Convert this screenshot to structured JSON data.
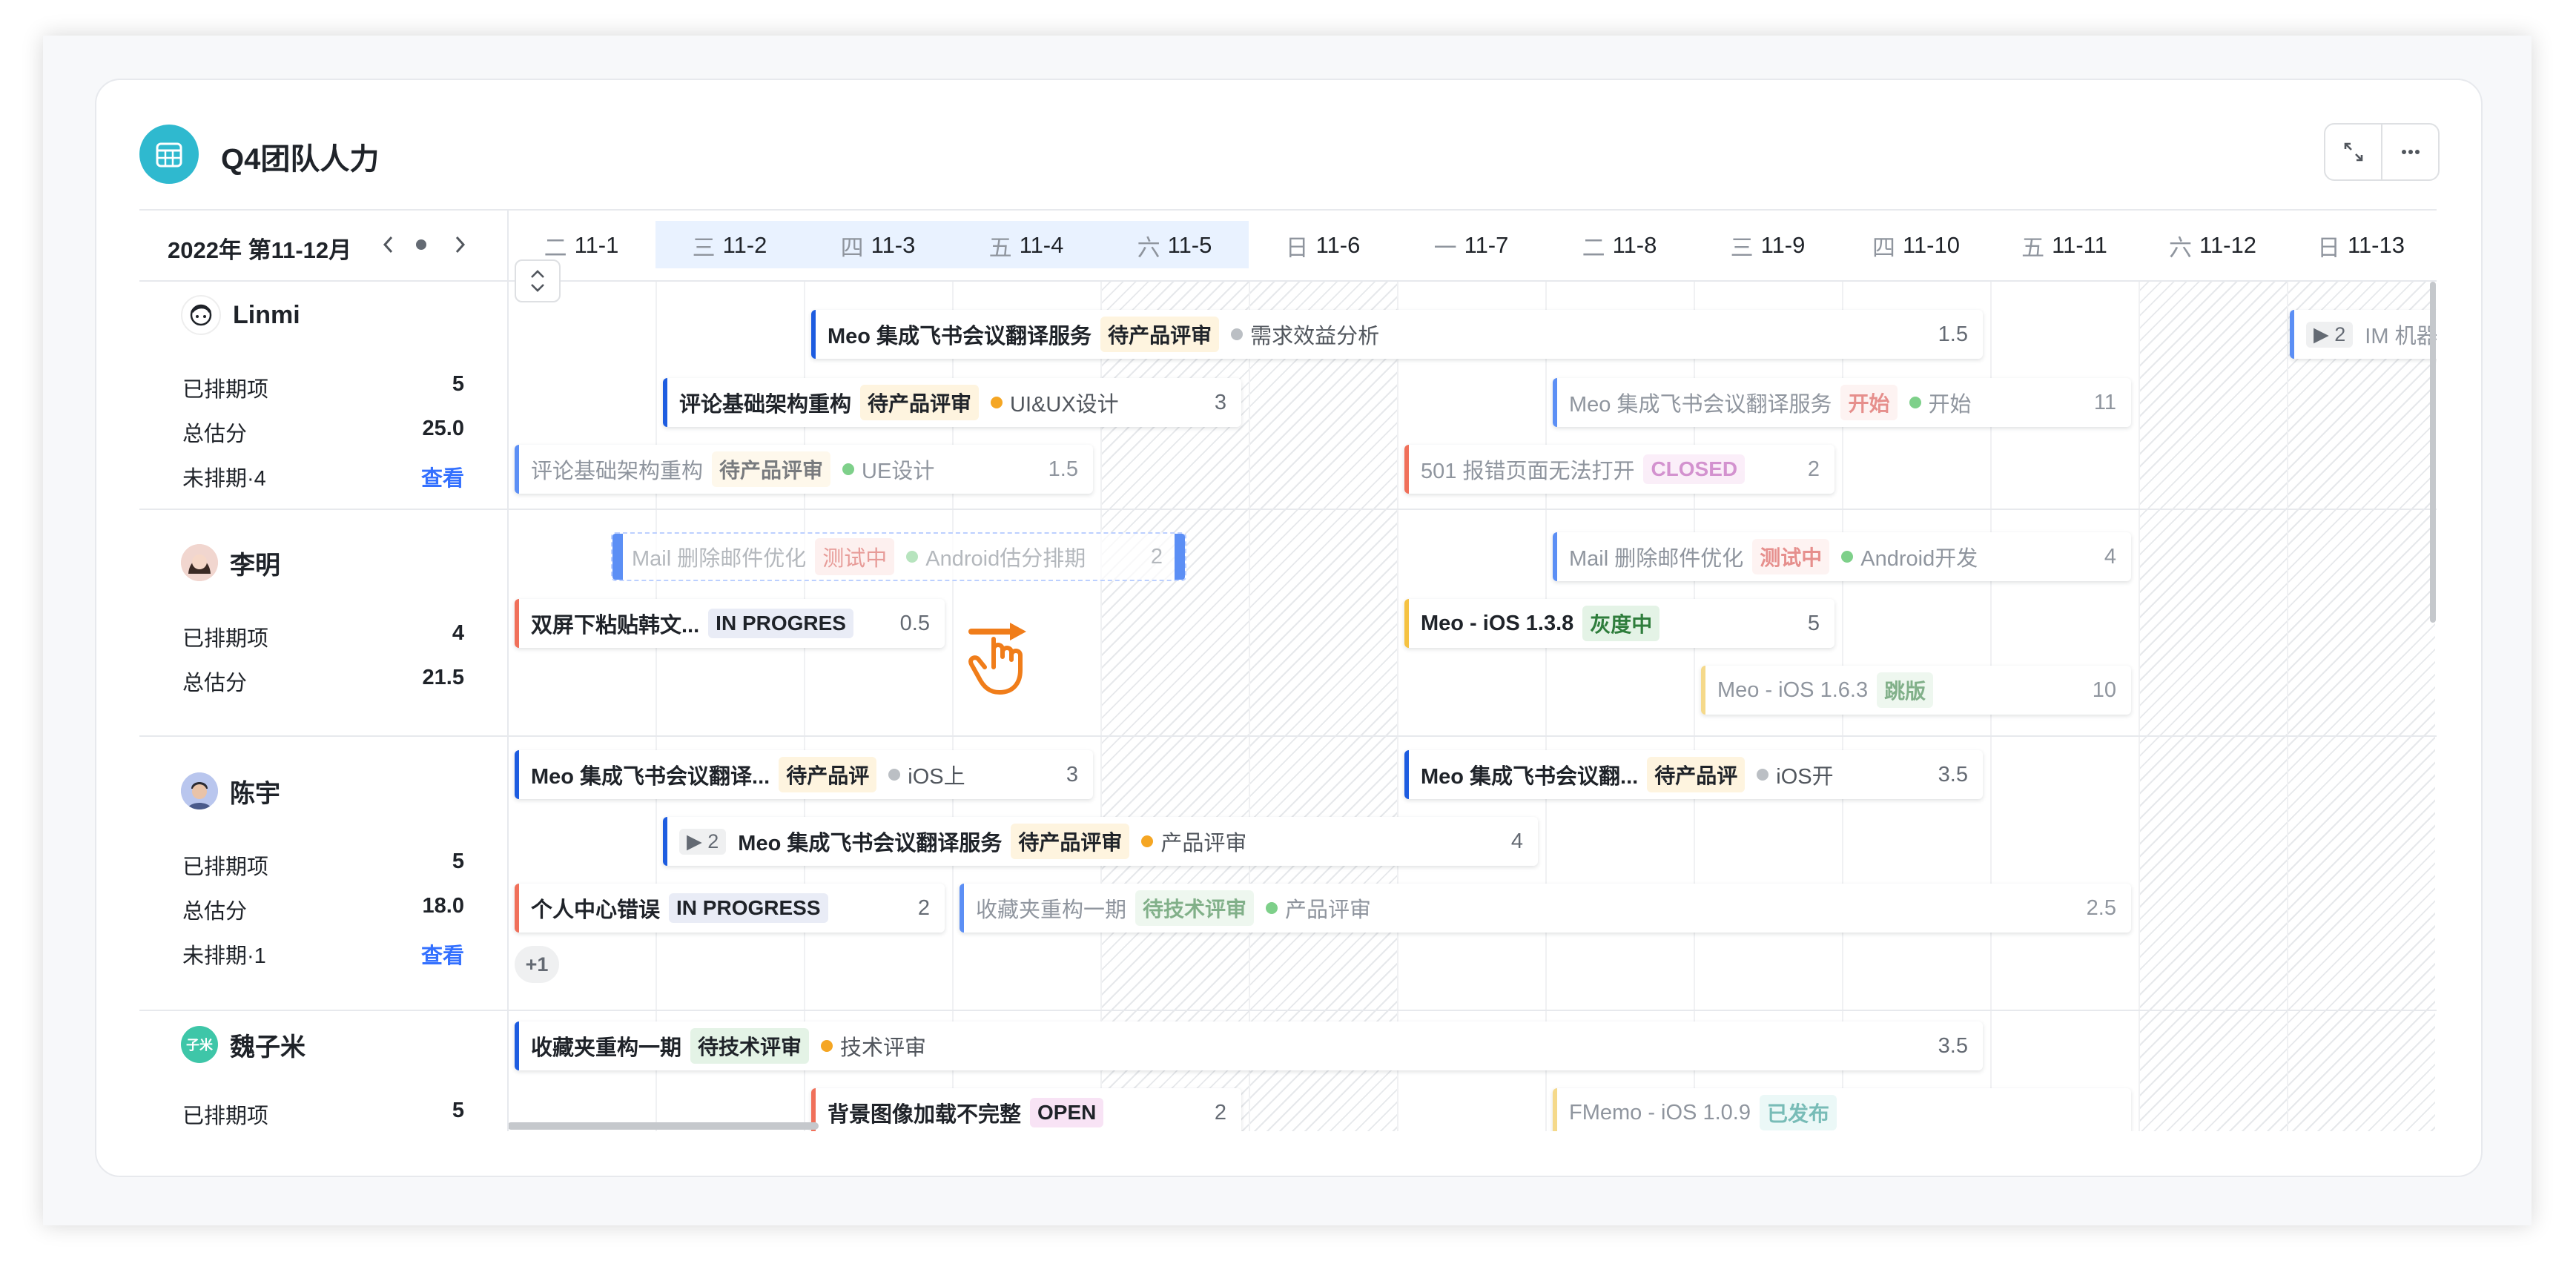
{
  "title": "Q4团队人力",
  "period": "2022年 第11-12月",
  "colors": {
    "accent": "#3370ff",
    "blue": "#1d5ce0",
    "yellow": "#f5c242",
    "red": "#f0705a",
    "header_icon": "#2fb9cf"
  },
  "dates": [
    {
      "wd": "二",
      "d": "11-1"
    },
    {
      "wd": "三",
      "d": "11-2"
    },
    {
      "wd": "四",
      "d": "11-3"
    },
    {
      "wd": "五",
      "d": "11-4"
    },
    {
      "wd": "六",
      "d": "11-5"
    },
    {
      "wd": "日",
      "d": "11-6"
    },
    {
      "wd": "一",
      "d": "11-7"
    },
    {
      "wd": "二",
      "d": "11-8"
    },
    {
      "wd": "三",
      "d": "11-9"
    },
    {
      "wd": "四",
      "d": "11-10"
    },
    {
      "wd": "五",
      "d": "11-11"
    },
    {
      "wd": "六",
      "d": "11-12"
    },
    {
      "wd": "日",
      "d": "11-13"
    }
  ],
  "stat_labels": {
    "scheduled": "已排期项",
    "estimate": "总估分",
    "view": "查看"
  },
  "people": [
    {
      "name": "Linmi",
      "scheduled": "5",
      "estimate": "25.0",
      "unscheduled": "未排期·4",
      "icon": "avatar-face-icon"
    },
    {
      "name": "李明",
      "scheduled": "4",
      "estimate": "21.5",
      "icon": "avatar-photo-icon"
    },
    {
      "name": "陈宇",
      "scheduled": "5",
      "estimate": "18.0",
      "unscheduled": "未排期·1",
      "icon": "avatar-photo-icon"
    },
    {
      "name": "魏子米",
      "scheduled": "5",
      "initials": "子米",
      "icon": "avatar-initials-icon"
    }
  ],
  "tasks": [
    {
      "name": "Meo 集成飞书会议翻译服务",
      "tag": "待产品评审",
      "phase": "需求效益分析",
      "num": "1.5"
    },
    {
      "count": "2",
      "name": "IM 机器"
    },
    {
      "name": "评论基础架构重构",
      "tag": "待产品评审",
      "phase": "UI&UX设计",
      "num": "3"
    },
    {
      "name": "Meo 集成飞书会议翻译服务",
      "tag": "开始",
      "phase": "开始",
      "num": "11"
    },
    {
      "name": "评论基础架构重构",
      "tag": "待产品评审",
      "phase": "UE设计",
      "num": "1.5"
    },
    {
      "name": "501 报错页面无法打开",
      "tag": "CLOSED",
      "num": "2"
    },
    {
      "name": "Mail 删除邮件优化",
      "tag": "测试中",
      "phase": "Android开发",
      "num": "4"
    },
    {
      "name": "双屏下粘贴韩文...",
      "tag": "IN PROGRES",
      "num": "0.5"
    },
    {
      "name": "Meo - iOS 1.3.8",
      "tag": "灰度中",
      "num": "5"
    },
    {
      "name": "Meo - iOS 1.6.3",
      "tag": "跳版",
      "num": "10"
    },
    {
      "name": "Meo 集成飞书会议翻译...",
      "tag": "待产品评",
      "phase": "iOS上",
      "num": "3"
    },
    {
      "name": "Meo 集成飞书会议翻...",
      "tag": "待产品评",
      "phase": "iOS开",
      "num": "3.5"
    },
    {
      "count": "2",
      "name": "Meo 集成飞书会议翻译服务",
      "tag": "待产品评审",
      "phase": "产品评审",
      "num": "4"
    },
    {
      "name": "个人中心错误",
      "tag": "IN PROGRESS",
      "num": "2"
    },
    {
      "name": "收藏夹重构一期",
      "tag": "待技术评审",
      "phase": "产品评审",
      "num": "2.5"
    },
    {
      "name": "收藏夹重构一期",
      "tag": "待技术评审",
      "phase": "技术评审",
      "num": "3.5"
    },
    {
      "name": "背景图像加载不完整",
      "tag": "OPEN",
      "num": "2"
    },
    {
      "name": "FMemo - iOS 1.0.9",
      "tag": "已发布"
    }
  ],
  "drag": {
    "name": "Mail 删除邮件优化",
    "tag": "测试中",
    "phase": "Android估分排期",
    "num": "2"
  },
  "more": "+1"
}
